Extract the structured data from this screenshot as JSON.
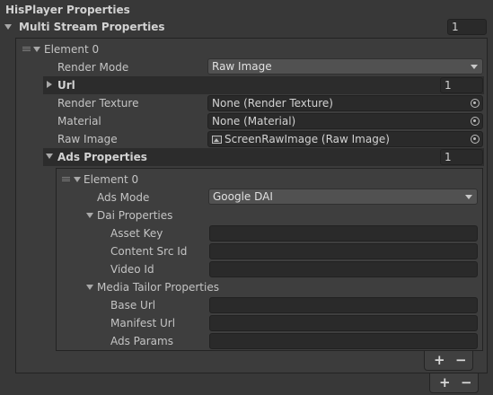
{
  "inspector": {
    "title": "HisPlayer Properties",
    "multi_stream": {
      "label": "Multi Stream Properties",
      "count": "1",
      "element": {
        "label": "Element 0",
        "render_mode": {
          "label": "Render Mode",
          "value": "Raw Image"
        },
        "url": {
          "label": "Url",
          "count": "1"
        },
        "render_texture": {
          "label": "Render Texture",
          "value": "None (Render Texture)"
        },
        "material": {
          "label": "Material",
          "value": "None (Material)"
        },
        "raw_image": {
          "label": "Raw Image",
          "value": "ScreenRawImage (Raw Image)"
        },
        "ads": {
          "label": "Ads Properties",
          "count": "1",
          "element": {
            "label": "Element 0",
            "ads_mode": {
              "label": "Ads Mode",
              "value": "Google DAI"
            },
            "dai": {
              "label": "Dai Properties",
              "asset_key": {
                "label": "Asset Key",
                "value": ""
              },
              "content_src_id": {
                "label": "Content Src Id",
                "value": ""
              },
              "video_id": {
                "label": "Video Id",
                "value": ""
              }
            },
            "media_tailor": {
              "label": "Media Tailor Properties",
              "base_url": {
                "label": "Base Url",
                "value": ""
              },
              "manifest_url": {
                "label": "Manifest Url",
                "value": ""
              },
              "ads_params": {
                "label": "Ads Params",
                "value": ""
              }
            }
          }
        }
      }
    },
    "list_buttons": {
      "add": "+",
      "remove": "−"
    }
  },
  "colors": {
    "background": "#383838",
    "field": "#2a2a2a",
    "header_bar": "#2c2c2c",
    "dropdown": "#515151",
    "text": "#c4c4c4"
  },
  "icons": [
    "foldout-arrow-icon",
    "drag-handle-icon",
    "dropdown-arrow-icon",
    "object-picker-icon",
    "raw-image-icon"
  ]
}
